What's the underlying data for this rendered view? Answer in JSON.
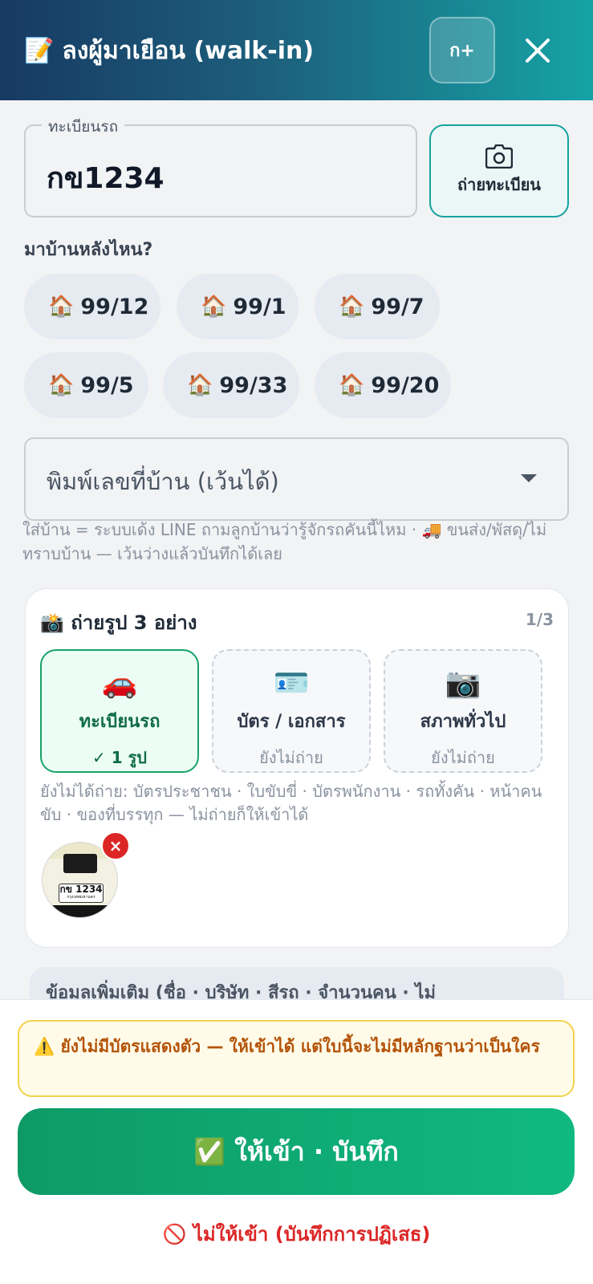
{
  "header": {
    "icon": "memo",
    "title": "ลงผู้มาเยือน (walk-in)",
    "kplus_label": "ก+",
    "close_icon": "close-icon"
  },
  "plate": {
    "legend": "ทะเบียนรถ",
    "value": "กข1234",
    "photo_button_label": "ถ่ายทะเบียน",
    "photo_button_icon": "camera-icon"
  },
  "house": {
    "question": "มาบ้านหลังไหน?",
    "chips": [
      "99/12",
      "99/1",
      "99/7",
      "99/5",
      "99/33",
      "99/20"
    ],
    "chip_icon": "🏠",
    "select_placeholder": "พิมพ์เลขที่บ้าน (เว้นได้)",
    "hint": "ใส่บ้าน = ระบบเด้ง LINE ถามลูกบ้านว่ารู้จักรถคันนี้ไหม · 🚚 ขนส่ง/พัสดุ/ไม่ทราบบ้าน — เว้นว่างแล้วบันทึกได้เลย"
  },
  "photos": {
    "icon": "📸",
    "title": "ถ่ายรูป 3 อย่าง",
    "count": "1/3",
    "tiles": [
      {
        "emoji": "🚗",
        "label": "ทะเบียนรถ",
        "status": "✓ 1 รูป",
        "done": true
      },
      {
        "emoji": "🪪",
        "label": "บัตร / เอกสาร",
        "status": "ยังไม่ถ่าย",
        "done": false
      },
      {
        "emoji": "📷",
        "label": "สภาพทั่วไป",
        "status": "ยังไม่ถ่าย",
        "done": false
      }
    ],
    "note": "ยังไม่ได้ถ่าย: บัตรประชาชน · ใบขับขี่ · บัตรพนักงาน · รถทั้งคัน · หน้าคนขับ · ของที่บรรทุก — ไม่ถ่ายก็ให้เข้าได้",
    "thumb_plate_text": "กข 1234",
    "thumb_plate_sub": "กรุงเทพมหานคร",
    "remove_label": "×"
  },
  "more_section": {
    "label": "ข้อมูลเพิ่มเติม (ชื่อ · บริษัท · สีรถ · จำนวนคน · ไม่"
  },
  "footer": {
    "warning": "⚠️ ยังไม่มีบัตรแสดงตัว — ให้เข้าได้ แต่ใบนี้จะไม่มีหลักฐานว่าเป็นใคร",
    "save_label": "✅ ให้เข้า · บันทึก",
    "deny_label": "🚫 ไม่ให้เข้า (บันทึกการปฏิเสธ)"
  },
  "colors": {
    "header_start": "#173a63",
    "header_end": "#15a3a5",
    "success": "#10b981",
    "danger": "#dc2626",
    "warning_bg": "#fffbe8"
  }
}
